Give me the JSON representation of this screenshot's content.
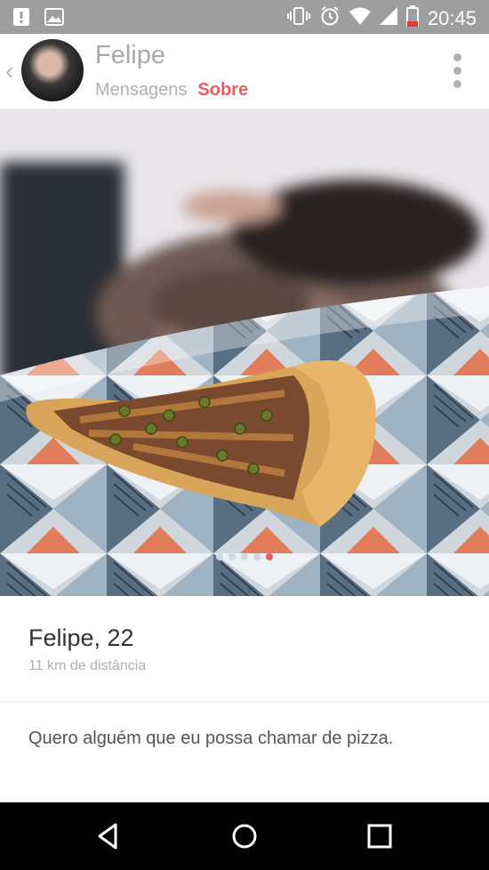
{
  "status_bar": {
    "time": "20:45",
    "icons": [
      "alert-icon",
      "image-icon",
      "vibrate-icon",
      "alarm-icon",
      "wifi-icon",
      "signal-icon",
      "battery-icon"
    ]
  },
  "header": {
    "name": "Felipe",
    "tabs": [
      {
        "label": "Mensagens",
        "active": false
      },
      {
        "label": "Sobre",
        "active": true
      }
    ]
  },
  "photo": {
    "dot_count": 5,
    "active_dot_index": 4
  },
  "profile": {
    "name_age": "Felipe, 22",
    "distance": "11 km de distância",
    "bio": "Quero alguém que eu possa chamar de pizza."
  },
  "colors": {
    "accent": "#ee5a62",
    "status_bar": "#9e9e9e",
    "nav_bar": "#000000"
  }
}
